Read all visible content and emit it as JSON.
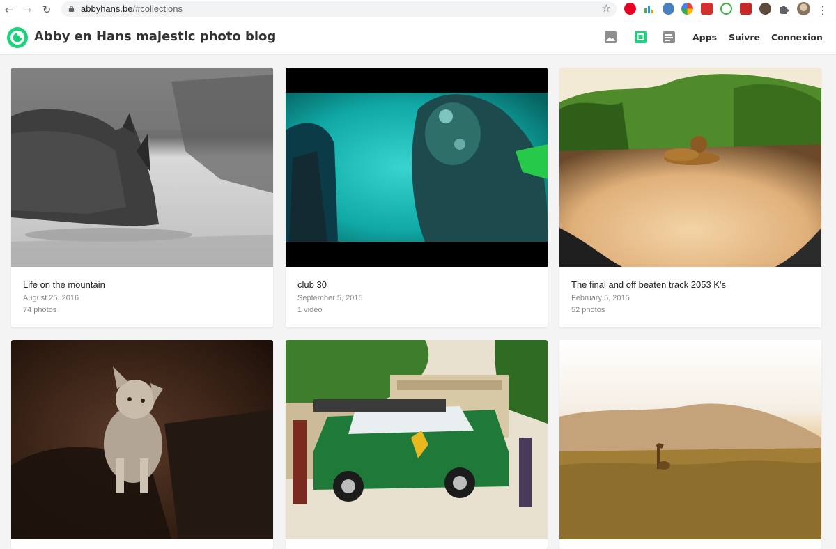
{
  "browser": {
    "url_host": "abbyhans.be",
    "url_rest": "/#collections"
  },
  "header": {
    "site_title": "Abby en Hans majestic photo blog",
    "nav": {
      "apps": "Apps",
      "follow": "Suivre",
      "login": "Connexion"
    },
    "icons": [
      "photos-icon",
      "collections-icon",
      "stories-icon"
    ],
    "accent_color": "#1ed17b"
  },
  "collections": [
    {
      "title": "Life on the mountain",
      "date": "August 25, 2016",
      "count": "74 photos"
    },
    {
      "title": "club 30",
      "date": "September 5, 2015",
      "count": "1 vidéo"
    },
    {
      "title": "The final and off beaten track 2053 K's",
      "date": "February 5, 2015",
      "count": "52 photos"
    },
    {
      "title": "",
      "date": "",
      "count": ""
    },
    {
      "title": "",
      "date": "",
      "count": ""
    },
    {
      "title": "",
      "date": "",
      "count": ""
    }
  ]
}
